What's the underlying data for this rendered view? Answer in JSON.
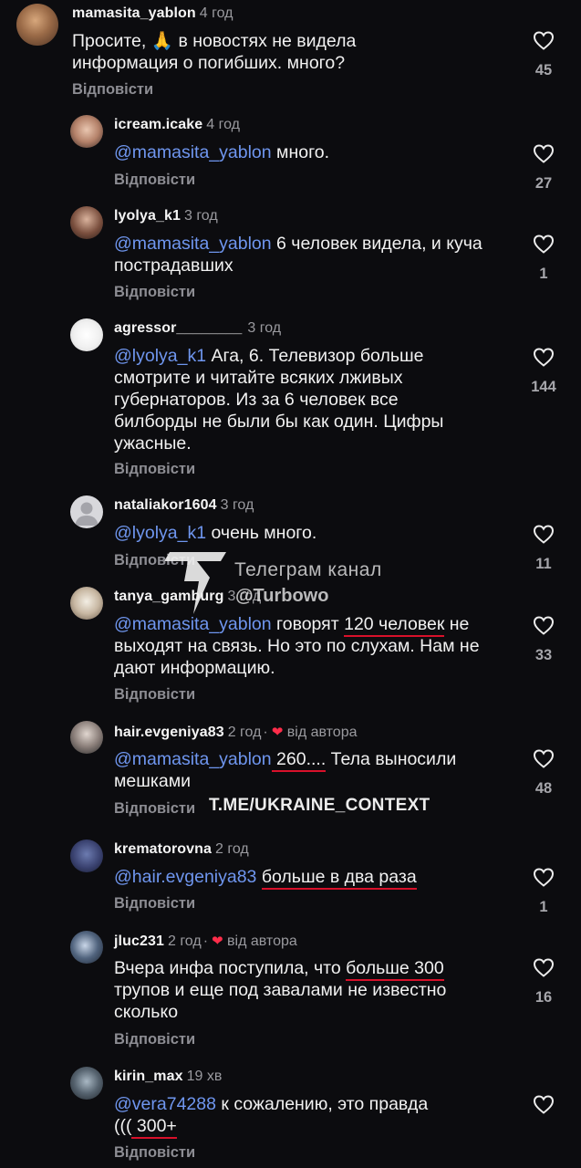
{
  "reply_label": "Відповісти",
  "author_badge": "від автора",
  "comments": [
    {
      "username": "mamasita_yablon",
      "time": "4 год",
      "body_pre": "Просите, ",
      "emoji": "🙏",
      "body_post": " в новостях не видела информация о погибших. много?",
      "likes": "45"
    },
    {
      "username": "icream.icake",
      "time": "4 год",
      "mention": "@mamasita_yablon",
      "body": " много.",
      "likes": "27"
    },
    {
      "username": "lyolya_k1",
      "time": "3 год",
      "mention": "@mamasita_yablon",
      "body": " 6 человек  видела, и куча пострадавших",
      "likes": "1"
    },
    {
      "username": "agressor________",
      "time": "3 год",
      "mention": "@lyolya_k1",
      "body": " Ага, 6. Телевизор больше смотрите и читайте всяких лживых губернаторов. Из за 6 человек все билборды не были бы как один. Цифры ужасные.",
      "likes": "144"
    },
    {
      "username": "nataliakor1604",
      "time": "3 год",
      "mention": "@lyolya_k1",
      "body": " очень много.",
      "likes": "11"
    },
    {
      "username": "tanya_gamburg",
      "time": "3 год",
      "mention": "@mamasita_yablon",
      "body_a": " говорят ",
      "body_ul": "120 человек",
      "body_b": " не выходят на связь. Но это по слухам. Нам не дают информацию.",
      "likes": "33"
    },
    {
      "username": "hair.evgeniya83",
      "time": "2 год",
      "mention": "@mamasita_yablon",
      "body_ul": " 260....",
      "body_b": " Тела выносили мешками",
      "likes": "48"
    },
    {
      "username": "krematorovna",
      "time": "2 год",
      "mention": "@hair.evgeniya83",
      "body_ul": "больше в два раза",
      "likes": "1"
    },
    {
      "username": "jluc231",
      "time": "2 год",
      "body_a": "Вчера инфа поступила, что ",
      "body_ul": "больше 300",
      "body_b": " трупов и еще под завалами не известно сколько",
      "likes": "16"
    },
    {
      "username": "kirin_max",
      "time": "19 хв",
      "mention": "@vera74288",
      "body_a": " к сожалению, это правда ",
      "body_c": "(((",
      "body_ul": " 300+",
      "likes": ""
    }
  ],
  "watermark": {
    "line1": "Телеграм канал",
    "line2": "@Turbowo",
    "line3": "T.ME/UKRAINE_CONTEXT"
  },
  "colors": {
    "background": "#0c0c0f",
    "mention": "#6f96ef",
    "underline": "#d8102a",
    "heart": "#ff2d4a"
  }
}
